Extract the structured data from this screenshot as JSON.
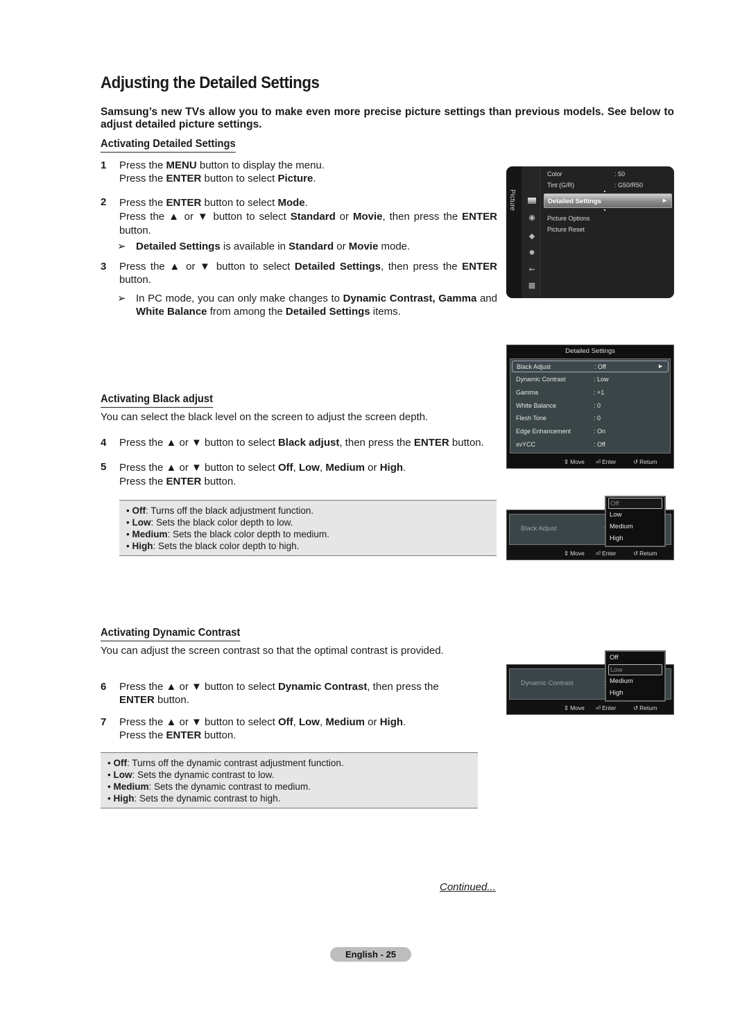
{
  "title": "Adjusting the Detailed Settings",
  "intro": "Samsung’s new TVs allow you to make even more precise picture settings than previous models. See below to adjust detailed picture settings.",
  "sections": {
    "activating_detailed": {
      "heading": "Activating Detailed Settings",
      "steps": [
        {
          "num": "1",
          "parts": [
            [
              "Press the ",
              ""
            ],
            [
              "MENU",
              "b"
            ],
            [
              " button to display the menu.",
              ""
            ],
            [
              "\n",
              "br"
            ],
            [
              "Press the ",
              ""
            ],
            [
              "ENTER",
              "b"
            ],
            [
              " button to select ",
              ""
            ],
            [
              "Picture",
              "b"
            ],
            [
              ".",
              ""
            ]
          ]
        },
        {
          "num": "2",
          "parts": [
            [
              "Press the ",
              ""
            ],
            [
              "ENTER",
              "b"
            ],
            [
              " button to select ",
              ""
            ],
            [
              "Mode",
              "b"
            ],
            [
              ".",
              ""
            ],
            [
              "\n",
              "br"
            ],
            [
              "Press the ▲ or ▼ button to select ",
              ""
            ],
            [
              "Standard",
              "b"
            ],
            [
              " or ",
              ""
            ],
            [
              "Movie",
              "b"
            ],
            [
              ", then press the ",
              ""
            ],
            [
              "ENTER",
              "b"
            ],
            [
              " button.",
              ""
            ]
          ]
        },
        {
          "num": "3",
          "parts": [
            [
              "Press the ▲ or ▼ button to select ",
              ""
            ],
            [
              "Detailed Settings",
              "b"
            ],
            [
              ", then press the ",
              ""
            ],
            [
              "ENTER",
              "b"
            ],
            [
              " button.",
              ""
            ]
          ]
        }
      ],
      "notes": [
        {
          "arrow": "➢",
          "parts": [
            [
              "Detailed Settings",
              "b"
            ],
            [
              " is available in ",
              ""
            ],
            [
              "Standard",
              "b"
            ],
            [
              " or ",
              ""
            ],
            [
              "Movie",
              "b"
            ],
            [
              " mode.",
              ""
            ]
          ]
        },
        {
          "arrow": "➢",
          "parts": [
            [
              "In PC mode, you can only make changes to ",
              ""
            ],
            [
              "Dynamic Contrast, Gamma",
              "b"
            ],
            [
              " and ",
              ""
            ],
            [
              "White Balance",
              "b"
            ],
            [
              " from among the ",
              ""
            ],
            [
              "Detailed Settings",
              "b"
            ],
            [
              " items.",
              ""
            ]
          ]
        }
      ]
    },
    "black_adjust": {
      "heading": "Activating Black adjust",
      "description": "You can select the black level on the screen to adjust the screen depth.",
      "steps": [
        {
          "num": "4",
          "parts": [
            [
              "Press the ▲ or ▼ button to select ",
              ""
            ],
            [
              "Black adjust",
              "b"
            ],
            [
              ", then press the ",
              ""
            ],
            [
              "ENTER",
              "b"
            ],
            [
              " button.",
              ""
            ]
          ]
        },
        {
          "num": "5",
          "parts": [
            [
              "Press the ▲ or ▼ button to select ",
              ""
            ],
            [
              "Off",
              "b"
            ],
            [
              ", ",
              ""
            ],
            [
              "Low",
              "b"
            ],
            [
              ", ",
              ""
            ],
            [
              "Medium",
              "b"
            ],
            [
              " or ",
              ""
            ],
            [
              "High",
              "b"
            ],
            [
              ".",
              ""
            ],
            [
              "\n",
              "br"
            ],
            [
              "Press the ",
              ""
            ],
            [
              "ENTER",
              "b"
            ],
            [
              " button.",
              ""
            ]
          ]
        }
      ],
      "bullets": [
        {
          "term": "Off",
          "text": ": Turns off the black adjustment function."
        },
        {
          "term": "Low",
          "text": ": Sets the black color depth to low."
        },
        {
          "term": "Medium",
          "text": ": Sets the black color depth to medium."
        },
        {
          "term": "High",
          "text": ": Sets the black color depth to high."
        }
      ]
    },
    "dynamic_contrast": {
      "heading": "Activating Dynamic Contrast",
      "description": "You can adjust the screen contrast so that the optimal contrast is provided.",
      "steps": [
        {
          "num": "6",
          "parts": [
            [
              "Press the ▲ or ▼ button to select ",
              ""
            ],
            [
              "Dynamic Contrast",
              "b"
            ],
            [
              ", then press the",
              ""
            ],
            [
              "\n",
              "br"
            ],
            [
              "ENTER",
              "b"
            ],
            [
              " button.",
              ""
            ]
          ]
        },
        {
          "num": "7",
          "parts": [
            [
              "Press the ▲ or ▼ button to select ",
              ""
            ],
            [
              "Off",
              "b"
            ],
            [
              ", ",
              ""
            ],
            [
              "Low",
              "b"
            ],
            [
              ", ",
              ""
            ],
            [
              "Medium",
              "b"
            ],
            [
              " or ",
              ""
            ],
            [
              "High",
              "b"
            ],
            [
              ".",
              ""
            ],
            [
              "\n",
              "br"
            ],
            [
              "Press the ",
              ""
            ],
            [
              "ENTER",
              "b"
            ],
            [
              " button.",
              ""
            ]
          ]
        }
      ],
      "bullets": [
        {
          "term": "Off",
          "text": ": Turns off the dynamic contrast adjustment function."
        },
        {
          "term": "Low",
          "text": ": Sets the dynamic contrast to low."
        },
        {
          "term": "Medium",
          "text": ": Sets the dynamic contrast to medium."
        },
        {
          "term": "High",
          "text": ": Sets the dynamic contrast to high."
        }
      ]
    }
  },
  "picture_menu": {
    "sidebar_label": "Picture",
    "icons": [
      "picture-icon",
      "sound-icon",
      "channel-icon",
      "setup-icon",
      "input-icon",
      "application-icon"
    ],
    "items": [
      {
        "label": "Color",
        "value": ": 50"
      },
      {
        "label": "Tint (G/R)",
        "value": ": G50/R50"
      },
      {
        "label": "Picture Options",
        "value": ""
      },
      {
        "label": "Picture Reset",
        "value": ""
      }
    ],
    "highlighted": {
      "label": "Detailed Settings",
      "arrow": "►"
    }
  },
  "detailed_menu": {
    "title": "Detailed Settings",
    "rows": [
      {
        "label": "Black Adjust",
        "value": ": Off",
        "selected": true
      },
      {
        "label": "Dynamic Contrast",
        "value": ": Low"
      },
      {
        "label": "Gamma",
        "value": ": +1"
      },
      {
        "label": "White Balance",
        "value": ": 0"
      },
      {
        "label": "Flesh Tone",
        "value": ": 0"
      },
      {
        "label": "Edge Enhancement",
        "value": ": On"
      },
      {
        "label": "xvYCC",
        "value": ": Off"
      }
    ],
    "selected_arrow": "►"
  },
  "footer_hints": {
    "move": "Move",
    "enter": "Enter",
    "return": "Return",
    "move_icon": "⇕",
    "enter_icon": "⏎",
    "return_icon": "↺"
  },
  "black_adjust_popup": {
    "label": "Black Adjust",
    "colon": ":",
    "options": [
      "Off",
      "Low",
      "Medium",
      "High"
    ],
    "selected": "Off"
  },
  "dynamic_contrast_popup": {
    "label": "Dynamic Contrast",
    "colon": ":",
    "options": [
      "Off",
      "Low",
      "Medium",
      "High"
    ],
    "selected": "Low"
  },
  "continued": "Continued...",
  "page_number": "English - 25"
}
